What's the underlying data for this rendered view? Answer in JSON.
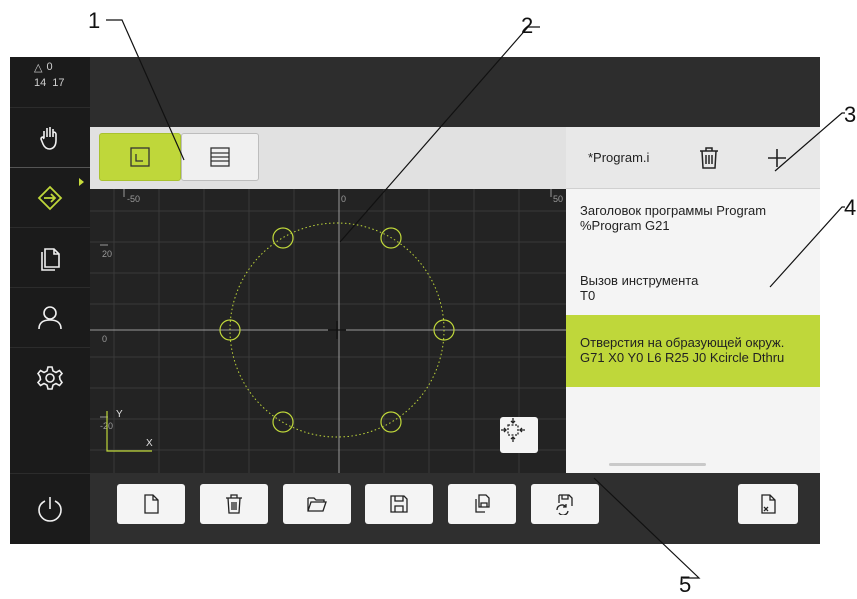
{
  "callouts": [
    "1",
    "2",
    "3",
    "4",
    "5"
  ],
  "status": {
    "warning_count": "0",
    "clock_hours": "14",
    "clock_minutes": "17"
  },
  "sidebar": {
    "items": [
      {
        "icon": "manual-hand-icon"
      },
      {
        "icon": "programming-arrow-icon",
        "active": true
      },
      {
        "icon": "files-icon"
      },
      {
        "icon": "user-icon"
      },
      {
        "icon": "settings-gear-icon"
      },
      {
        "icon": "power-icon"
      }
    ]
  },
  "graphic": {
    "x_ticks": [
      "-50",
      "0",
      "50"
    ],
    "y_ticks": [
      "20",
      "0",
      "-20"
    ],
    "axis_x_label": "X",
    "axis_y_label": "Y"
  },
  "program": {
    "name": "*Program.i",
    "blocks": [
      {
        "line1": "Заголовок программы Program",
        "line2": "%Program G21"
      },
      {
        "line1": "Вызов инструмента",
        "line2": "T0"
      },
      {
        "line1": "Отверстия на образующей окруж.",
        "line2": "G71 X0 Y0 L6 R25 J0 Kcircle Dthru"
      }
    ]
  },
  "toolbar": {
    "buttons": [
      "new-program-icon",
      "delete-icon",
      "open-folder-icon",
      "save-icon",
      "save-as-icon",
      "save-reload-icon",
      "export-icon"
    ]
  },
  "colors": {
    "accent": "#bfd73a",
    "sidebar_bg": "#1b1b1b",
    "canvas_bg": "#232323",
    "circle_color": "#bfd73a"
  }
}
